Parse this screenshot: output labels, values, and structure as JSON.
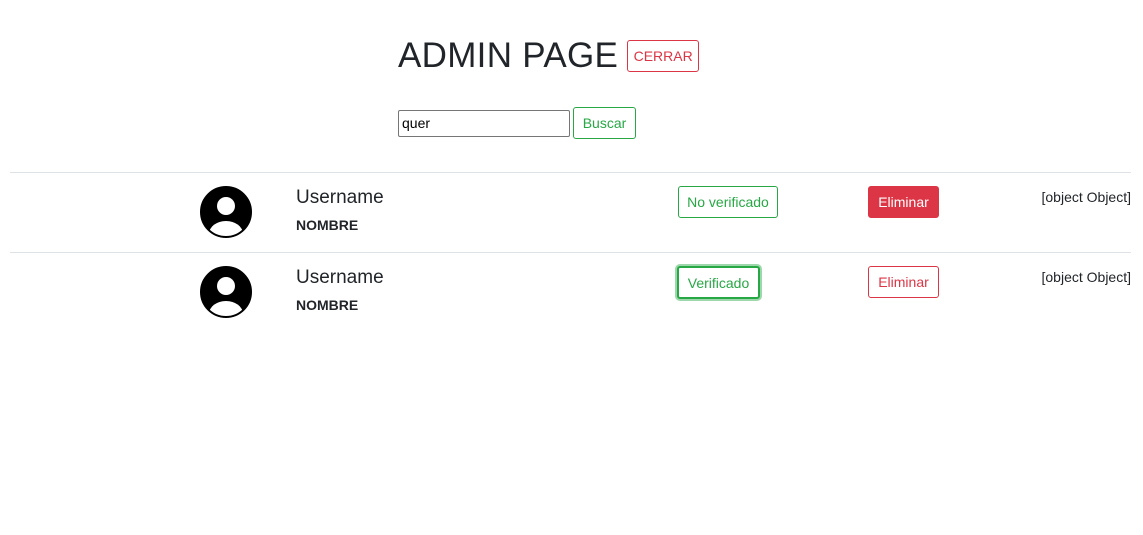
{
  "header": {
    "title": "ADMIN PAGE",
    "close_label": "CERRAR"
  },
  "search": {
    "value": "quer",
    "button_label": "Buscar"
  },
  "users": [
    {
      "username": "Username",
      "name": "NOMBRE",
      "verify_label": "No verificado",
      "verified": false,
      "delete_label": "Eliminar",
      "extra": "[object Object]"
    },
    {
      "username": "Username",
      "name": "NOMBRE",
      "verify_label": "Verificado",
      "verified": true,
      "delete_label": "Eliminar",
      "extra": "[object Object]"
    }
  ],
  "colors": {
    "danger": "#dc3545",
    "success": "#28a745",
    "text": "#212529",
    "divider": "#dee2e6"
  },
  "icons": {
    "avatar": "user-circle-icon"
  }
}
